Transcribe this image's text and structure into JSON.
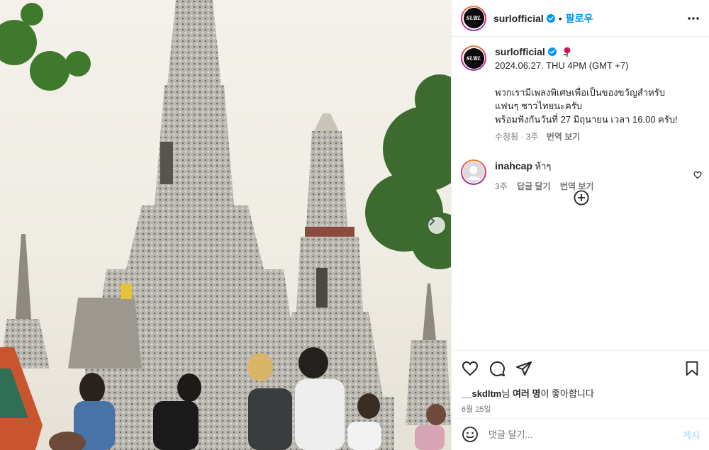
{
  "post": {
    "account": "surlofficial",
    "account_logo_text": "SURL",
    "follow_label": "팔로우",
    "dot": "•",
    "caption_meta_line": "2024.06.27. THU 4PM (GMT +7)",
    "caption_lines": [
      "พวกเรามีเพลงพิเศษเพื่อเป็นของขวัญสำหรับ",
      "แฟนๆ ชาวไทยนะครับ",
      "พร้อมฟังกันวันที่ 27 มิถุนายน เวลา 16.00 ครับ!"
    ],
    "caption_edited": "수정됨 · 3주",
    "caption_translate": "번역 보기"
  },
  "comments": [
    {
      "user": "inahcap",
      "text": "ห้าๆ",
      "age": "3주",
      "reply_label": "답글 달기",
      "translate_label": "번역 보기"
    }
  ],
  "engagement": {
    "liked_by_user": "__skdltm",
    "liked_by_suffix": "님 ",
    "others": "여러 명",
    "likes_suffix": "이 좋아합니다",
    "date": "6월 25일"
  },
  "comment_box": {
    "placeholder": "댓글 달기...",
    "post_label": "게시"
  },
  "icons": {
    "more": "more-horizontal-icon",
    "verified": "verified-badge-icon",
    "emoji_badge": "rose-emoji-icon",
    "like": "heart-icon",
    "comment": "comment-bubble-icon",
    "share": "paper-plane-icon",
    "save": "bookmark-icon",
    "emoji": "smiley-icon",
    "next": "chevron-right-icon",
    "load_more": "plus-circle-icon"
  },
  "colors": {
    "link_blue": "#0095f6",
    "verified_blue": "#0095f6",
    "muted": "#737373",
    "post_disabled": "#b2dffc"
  }
}
